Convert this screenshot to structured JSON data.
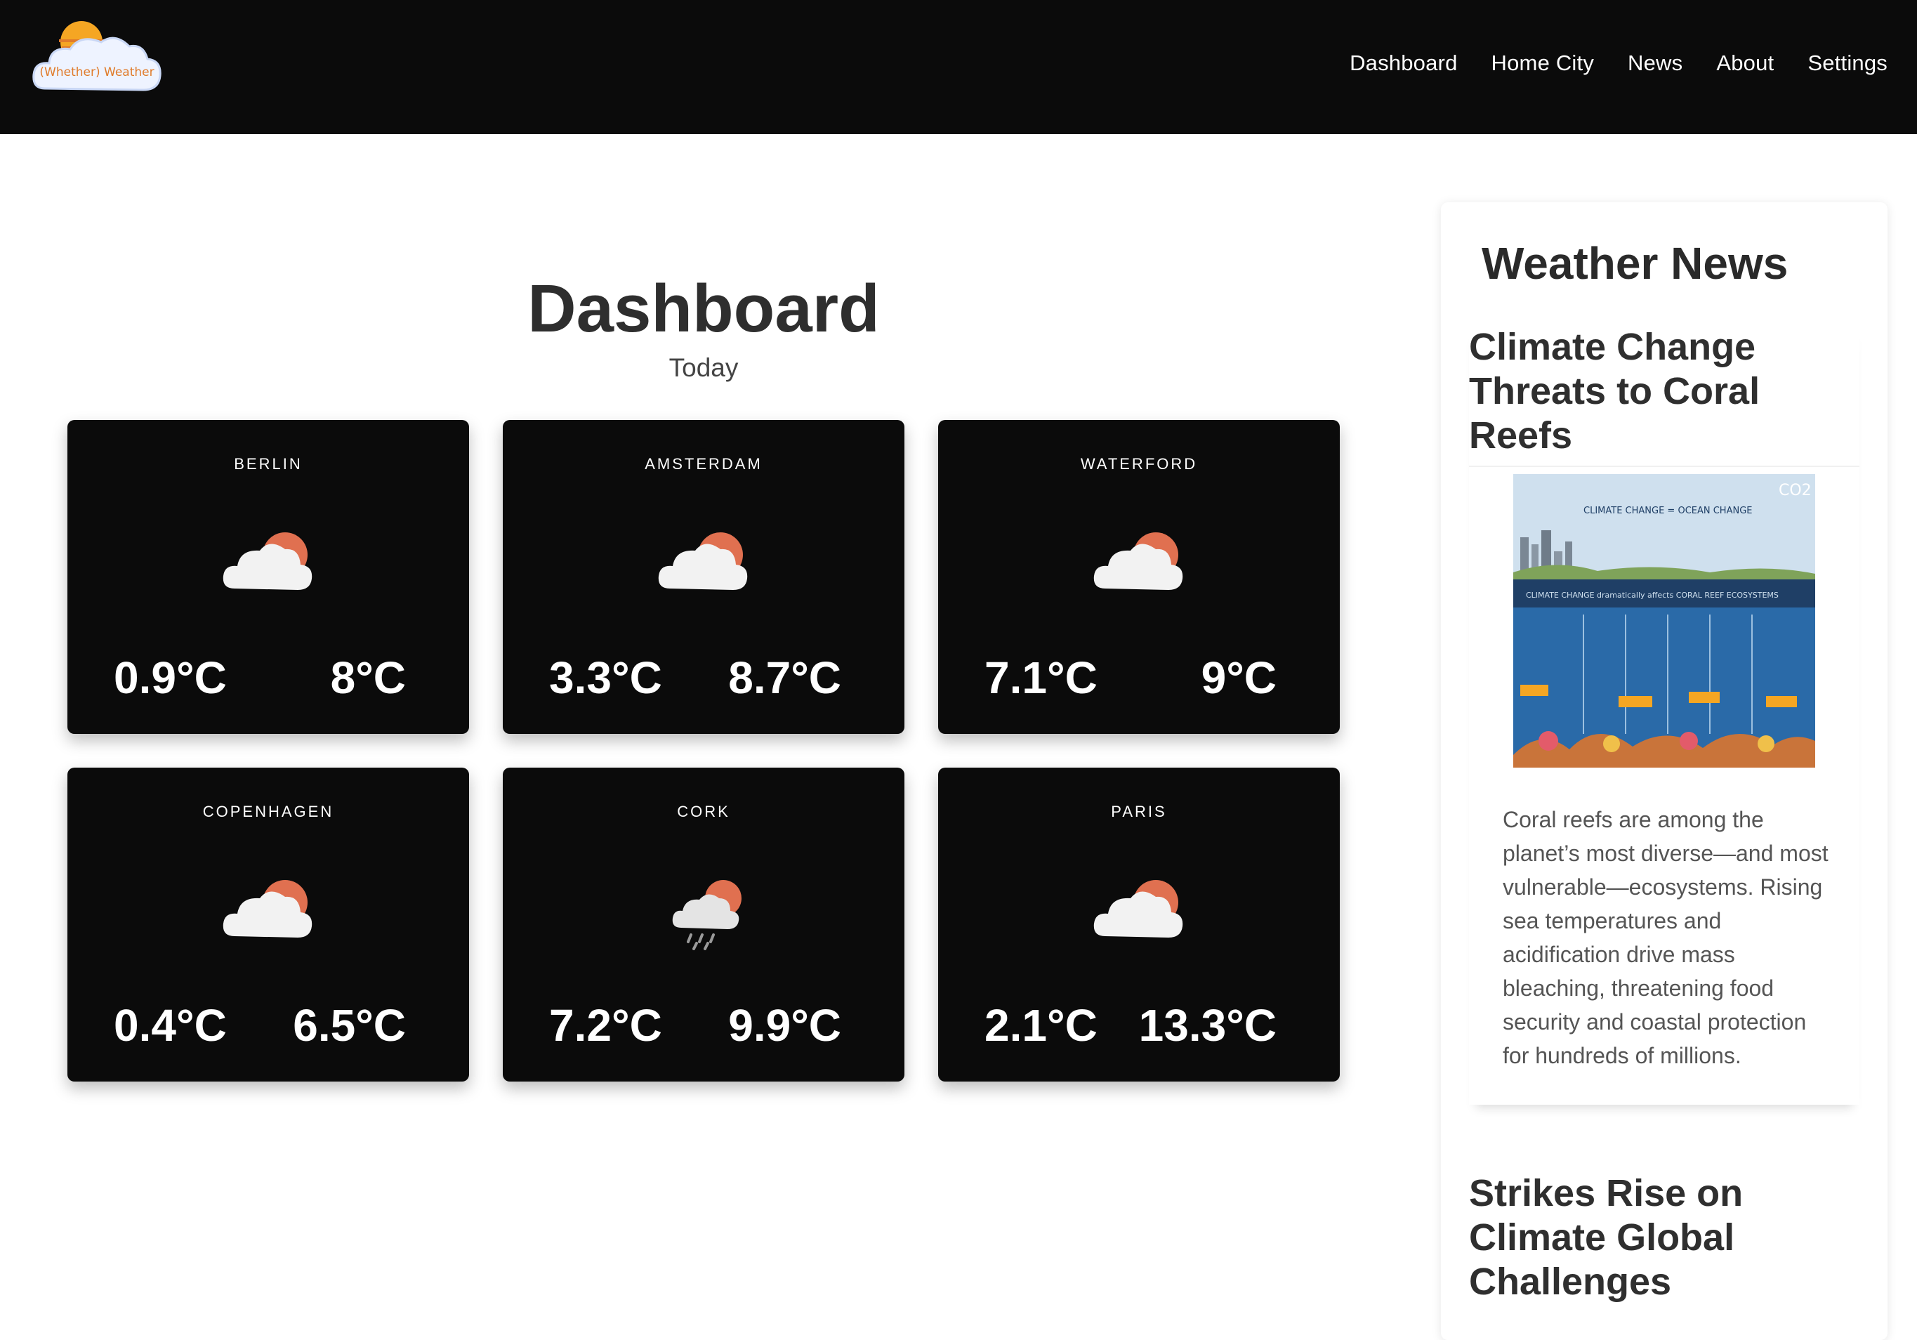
{
  "header": {
    "logo_text": "(Whether) Weather",
    "nav": [
      "Dashboard",
      "Home City",
      "News",
      "About",
      "Settings"
    ]
  },
  "dashboard": {
    "title": "Dashboard",
    "subtitle": "Today",
    "cities": [
      {
        "name": "BERLIN",
        "min": "0.9°C",
        "max": "8°C",
        "icon": "partly-cloudy-icon"
      },
      {
        "name": "AMSTERDAM",
        "min": "3.3°C",
        "max": "8.7°C",
        "icon": "partly-cloudy-icon"
      },
      {
        "name": "WATERFORD",
        "min": "7.1°C",
        "max": "9°C",
        "icon": "partly-cloudy-icon"
      },
      {
        "name": "COPENHAGEN",
        "min": "0.4°C",
        "max": "6.5°C",
        "icon": "partly-cloudy-icon"
      },
      {
        "name": "CORK",
        "min": "7.2°C",
        "max": "9.9°C",
        "icon": "rain-cloud-sun-icon"
      },
      {
        "name": "PARIS",
        "min": "2.1°C",
        "max": "13.3°C",
        "icon": "partly-cloudy-icon"
      }
    ]
  },
  "news": {
    "heading": "Weather News",
    "articles": [
      {
        "title": "Climate Change Threats to Coral Reefs",
        "image_caption": "CLIMATE CHANGE = OCEAN CHANGE",
        "image_band": "CLIMATE CHANGE dramatically affects CORAL REEF ECOSYSTEMS",
        "image_co2": "CO2",
        "body": "Coral reefs are among the planet’s most diverse—and most vulnerable—ecosystems. Rising sea temperatures and acidification drive mass bleaching, threatening food security and coastal protection for hundreds of millions."
      },
      {
        "title": "Strikes Rise on Climate Global Challenges"
      }
    ]
  },
  "colors": {
    "header_bg": "#0b0b0b",
    "card_bg": "#0b0b0b",
    "sun": "#e07050",
    "cloud": "#f2f2f2"
  }
}
